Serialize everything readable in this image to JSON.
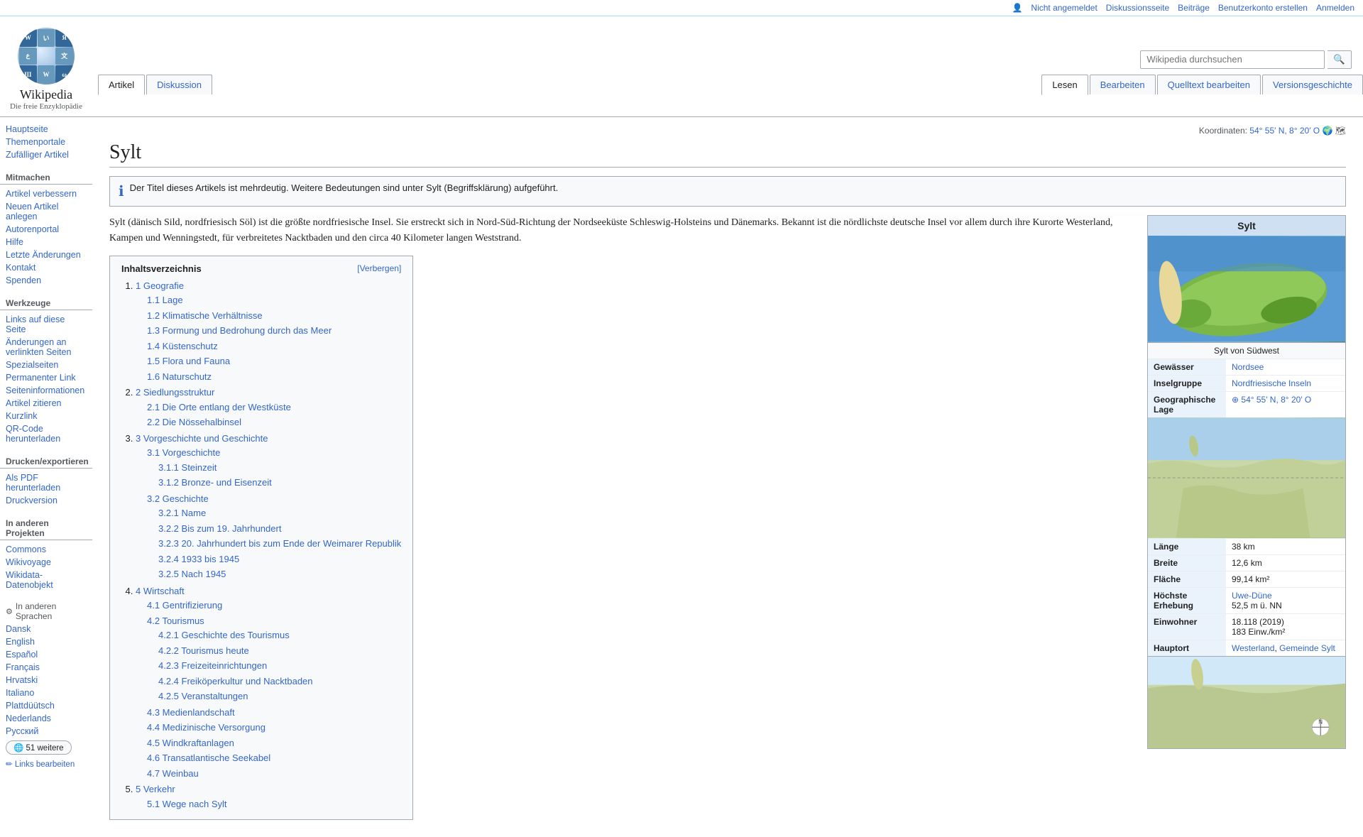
{
  "topbar": {
    "not_logged_in": "Nicht angemeldet",
    "discussion": "Diskussionsseite",
    "contributions": "Beiträge",
    "create_account": "Benutzerkonto erstellen",
    "login": "Anmelden"
  },
  "header": {
    "logo_title": "Wikipedia",
    "logo_subtitle": "Die freie Enzyklopädie",
    "search_placeholder": "Wikipedia durchsuchen",
    "tabs": [
      {
        "label": "Artikel",
        "active": true
      },
      {
        "label": "Diskussion",
        "active": false
      }
    ],
    "view_tabs": [
      {
        "label": "Lesen",
        "active": true
      },
      {
        "label": "Bearbeiten",
        "active": false
      },
      {
        "label": "Quelltext bearbeiten",
        "active": false
      },
      {
        "label": "Versionsgeschichte",
        "active": false
      }
    ],
    "coords": "54° 55′ N, 8° 20′ O"
  },
  "sidebar": {
    "navigation": {
      "title": "",
      "items": [
        {
          "label": "Hauptseite"
        },
        {
          "label": "Themenportale"
        },
        {
          "label": "Zufälliger Artikel"
        }
      ]
    },
    "participate": {
      "title": "Mitmachen",
      "items": [
        {
          "label": "Artikel verbessern"
        },
        {
          "label": "Neuen Artikel anlegen"
        },
        {
          "label": "Autorenportal"
        },
        {
          "label": "Hilfe"
        },
        {
          "label": "Letzte Änderungen"
        },
        {
          "label": "Kontakt"
        },
        {
          "label": "Spenden"
        }
      ]
    },
    "tools": {
      "title": "Werkzeuge",
      "items": [
        {
          "label": "Links auf diese Seite"
        },
        {
          "label": "Änderungen an verlinkten Seiten"
        },
        {
          "label": "Spezialseiten"
        },
        {
          "label": "Permanenter Link"
        },
        {
          "label": "Seiteninformationen"
        },
        {
          "label": "Artikel zitieren"
        },
        {
          "label": "Kurzlink"
        },
        {
          "label": "QR-Code herunterladen"
        }
      ]
    },
    "print": {
      "title": "Drucken/exportieren",
      "items": [
        {
          "label": "Als PDF herunterladen"
        },
        {
          "label": "Druckversion"
        }
      ]
    },
    "other_projects": {
      "title": "In anderen Projekten",
      "items": [
        {
          "label": "Commons"
        },
        {
          "label": "Wikivoyage"
        },
        {
          "label": "Wikidata-Datenobjekt"
        }
      ]
    },
    "languages": {
      "title": "In anderen Sprachen",
      "items": [
        {
          "label": "Dansk"
        },
        {
          "label": "English"
        },
        {
          "label": "Español"
        },
        {
          "label": "Français"
        },
        {
          "label": "Hrvatski"
        },
        {
          "label": "Italiano"
        },
        {
          "label": "Plattdüütsch"
        },
        {
          "label": "Nederlands"
        },
        {
          "label": "Русский"
        }
      ],
      "more_label": "51 weitere",
      "edit_label": "Links bearbeiten"
    }
  },
  "article": {
    "title": "Sylt",
    "disambiguation": "Der Titel dieses Artikels ist mehrdeutig. Weitere Bedeutungen sind unter Sylt (Begriffsklärung) aufgeführt.",
    "intro": "Sylt (dänisch Sild, nordfriesisch Söl) ist die größte nordfriesische Insel. Sie erstreckt sich in Nord-Süd-Richtung der Nordseeküste Schleswig-Holsteins und Dänemarks. Bekannt ist die nördlichste deutsche Insel vor allem durch ihre Kurorte Westerland, Kampen und Wenningstedt, für verbreitetes Nacktbaden und den circa 40 Kilometer langen Weststrand."
  },
  "toc": {
    "title": "Inhaltsverzeichnis",
    "toggle_label": "[Verbergen]",
    "items": [
      {
        "num": "1",
        "label": "Geografie",
        "sub": [
          {
            "num": "1.1",
            "label": "Lage"
          },
          {
            "num": "1.2",
            "label": "Klimatische Verhältnisse"
          },
          {
            "num": "1.3",
            "label": "Formung und Bedrohung durch das Meer"
          },
          {
            "num": "1.4",
            "label": "Küstenschutz"
          },
          {
            "num": "1.5",
            "label": "Flora und Fauna"
          },
          {
            "num": "1.6",
            "label": "Naturschutz"
          }
        ]
      },
      {
        "num": "2",
        "label": "Siedlungsstruktur",
        "sub": [
          {
            "num": "2.1",
            "label": "Die Orte entlang der Westküste"
          },
          {
            "num": "2.2",
            "label": "Die Nössehalbinsel"
          }
        ]
      },
      {
        "num": "3",
        "label": "Vorgeschichte und Geschichte",
        "sub": [
          {
            "num": "3.1",
            "label": "Vorgeschichte",
            "subsub": [
              {
                "num": "3.1.1",
                "label": "Steinzeit"
              },
              {
                "num": "3.1.2",
                "label": "Bronze- und Eisenzeit"
              }
            ]
          },
          {
            "num": "3.2",
            "label": "Geschichte",
            "subsub": [
              {
                "num": "3.2.1",
                "label": "Name"
              },
              {
                "num": "3.2.2",
                "label": "Bis zum 19. Jahrhundert"
              },
              {
                "num": "3.2.3",
                "label": "20. Jahrhundert bis zum Ende der Weimarer Republik"
              },
              {
                "num": "3.2.4",
                "label": "1933 bis 1945"
              },
              {
                "num": "3.2.5",
                "label": "Nach 1945"
              }
            ]
          }
        ]
      },
      {
        "num": "4",
        "label": "Wirtschaft",
        "sub": [
          {
            "num": "4.1",
            "label": "Gentrifizierung"
          },
          {
            "num": "4.2",
            "label": "Tourismus",
            "subsub": [
              {
                "num": "4.2.1",
                "label": "Geschichte des Tourismus"
              },
              {
                "num": "4.2.2",
                "label": "Tourismus heute"
              },
              {
                "num": "4.2.3",
                "label": "Freizeiteinrichtungen"
              },
              {
                "num": "4.2.4",
                "label": "Freiköperkultur und Nacktbaden"
              },
              {
                "num": "4.2.5",
                "label": "Veranstaltungen"
              }
            ]
          },
          {
            "num": "4.3",
            "label": "Medienlandschaft"
          },
          {
            "num": "4.4",
            "label": "Medizinische Versorgung"
          },
          {
            "num": "4.5",
            "label": "Windkraftanlagen"
          },
          {
            "num": "4.6",
            "label": "Transatlantische Seekabel"
          },
          {
            "num": "4.7",
            "label": "Weinbau"
          }
        ]
      },
      {
        "num": "5",
        "label": "Verkehr",
        "sub": [
          {
            "num": "5.1",
            "label": "Wege nach Sylt"
          }
        ]
      }
    ]
  },
  "infobox": {
    "title": "Sylt",
    "image_caption": "Sylt von Südwest",
    "rows": [
      {
        "label": "Gewässer",
        "value": "Nordsee"
      },
      {
        "label": "Inselgruppe",
        "value": "Nordfriesische Inseln"
      },
      {
        "label": "Geographische Lage",
        "value": "54° 55′ N, 8° 20′ O"
      },
      {
        "label": "Länge",
        "value": "38 km"
      },
      {
        "label": "Breite",
        "value": "12,6 km"
      },
      {
        "label": "Fläche",
        "value": "99,14 km²"
      },
      {
        "label": "Höchste Erhebung",
        "value": "Uwe-Düne\n52,5 m ü. NN"
      },
      {
        "label": "Einwohner",
        "value": "18.118 (2019)\n183 Einw./km²"
      },
      {
        "label": "Hauptort",
        "value": "Westerland, Gemeinde Sylt"
      }
    ]
  }
}
